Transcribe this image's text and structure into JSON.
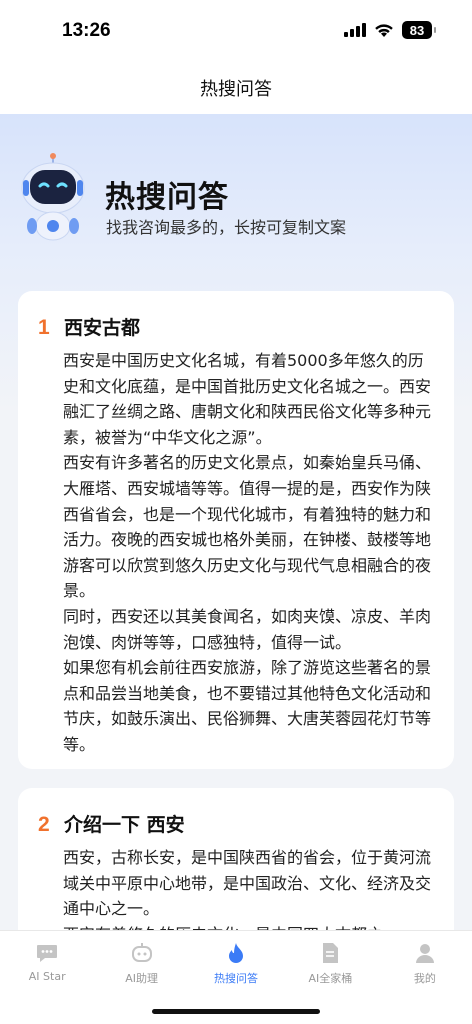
{
  "status": {
    "time": "13:26",
    "battery": "83",
    "icons": [
      "signal-icon",
      "wifi-icon",
      "battery-icon"
    ]
  },
  "nav": {
    "title": "热搜问答"
  },
  "hero": {
    "title": "热搜问答",
    "subtitle": "找我咨询最多的，长按可复制文案",
    "mascot": "robot-mascot"
  },
  "cards": [
    {
      "num": "1",
      "title": "西安古都",
      "paragraphs": [
        "西安是中国历史文化名城，有着5000多年悠久的历史和文化底蕴，是中国首批历史文化名城之一。西安融汇了丝绸之路、唐朝文化和陕西民俗文化等多种元素，被誉为“中华文化之源”。",
        "西安有许多著名的历史文化景点，如秦始皇兵马俑、大雁塔、西安城墙等等。值得一提的是，西安作为陕西省省会，也是一个现代化城市，有着独特的魅力和活力。夜晚的西安城也格外美丽，在钟楼、鼓楼等地游客可以欣赏到悠久历史文化与现代气息相融合的夜景。",
        "同时，西安还以其美食闻名，如肉夹馍、凉皮、羊肉泡馍、肉饼等等，口感独特，值得一试。",
        "如果您有机会前往西安旅游，除了游览这些著名的景点和品尝当地美食，也不要错过其他特色文化活动和节庆，如鼓乐演出、民俗狮舞、大唐芙蓉园花灯节等等。"
      ]
    },
    {
      "num": "2",
      "title": "介绍一下 西安",
      "paragraphs": [
        "西安，古称长安，是中国陕西省的省会，位于黄河流域关中平原中心地带，是中国政治、文化、经济及交通中心之一。",
        "西安有着悠久的历史文化，是中国四大古都之"
      ]
    }
  ],
  "tabs": [
    {
      "label": "AI Star",
      "icon": "chat-bubble-icon",
      "active": false
    },
    {
      "label": "AI助理",
      "icon": "robot-head-icon",
      "active": false
    },
    {
      "label": "热搜问答",
      "icon": "flame-icon",
      "active": true
    },
    {
      "label": "AI全家桶",
      "icon": "document-icon",
      "active": false
    },
    {
      "label": "我的",
      "icon": "person-icon",
      "active": false
    }
  ],
  "colors": {
    "accent": "#3b7bf6",
    "number": "#f0712d",
    "inactive": "#c4c4c4"
  }
}
